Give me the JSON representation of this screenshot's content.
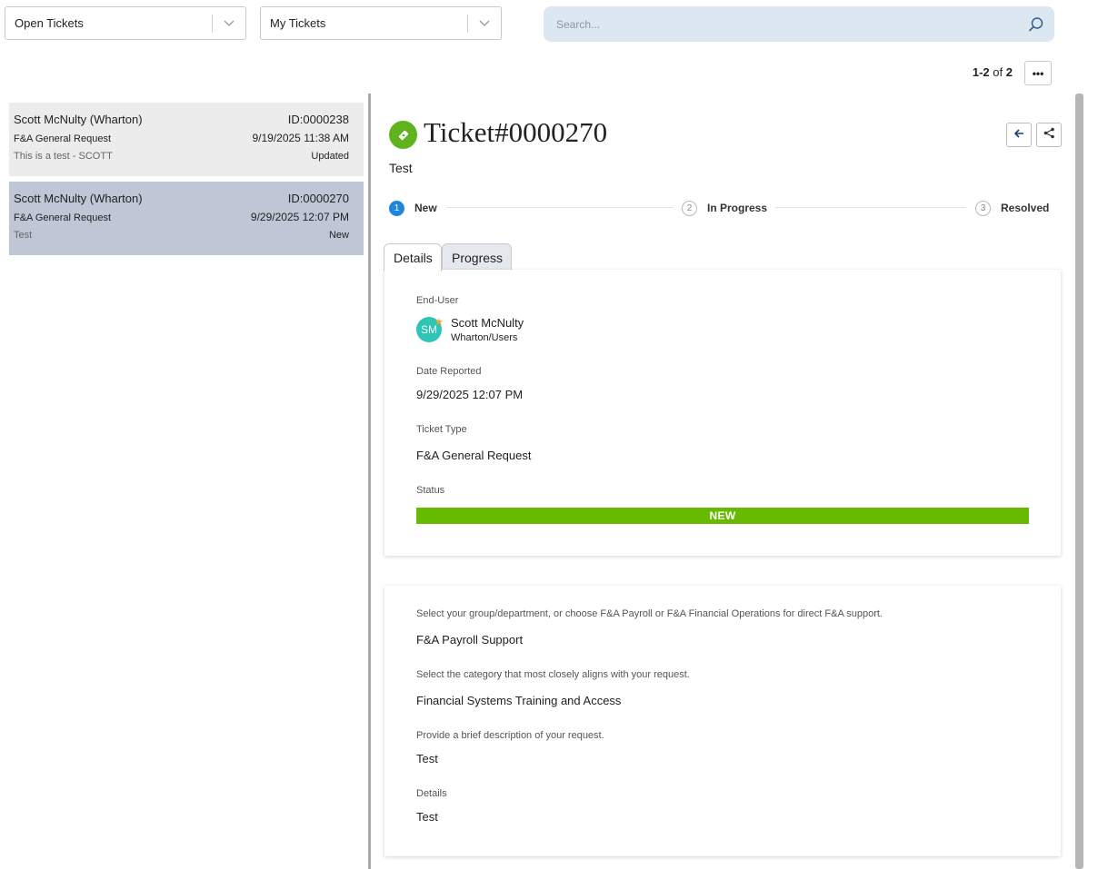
{
  "filters": {
    "queue": {
      "label": "Open Tickets"
    },
    "view": {
      "label": "My Tickets"
    }
  },
  "search": {
    "placeholder": "Search...",
    "icon": "search-icon"
  },
  "pager": {
    "range": "1-2",
    "of": "of",
    "total": "2",
    "more": "•••"
  },
  "tickets": [
    {
      "name": "Scott McNulty (Wharton)",
      "id": "ID:0000238",
      "type": "F&A General Request",
      "date": "9/19/2025 11:38 AM",
      "desc": "This is a test - SCOTT",
      "status": "Updated"
    },
    {
      "name": "Scott McNulty (Wharton)",
      "id": "ID:0000270",
      "type": "F&A General Request",
      "date": "9/29/2025 12:07 PM",
      "desc": "Test",
      "status": "New"
    }
  ],
  "detail": {
    "title": "Ticket#0000270",
    "subtitle": "Test",
    "steps": [
      {
        "num": "1",
        "label": "New",
        "active": true
      },
      {
        "num": "2",
        "label": "In Progress",
        "active": false
      },
      {
        "num": "3",
        "label": "Resolved",
        "active": false
      }
    ],
    "tabs": {
      "details": "Details",
      "progress": "Progress"
    },
    "fields": {
      "end_user_label": "End-User",
      "user_initials": "SM",
      "user_name": "Scott McNulty",
      "user_group": "Wharton/Users",
      "date_label": "Date Reported",
      "date_value": "9/29/2025 12:07 PM",
      "type_label": "Ticket Type",
      "type_value": "F&A General Request",
      "status_label": "Status",
      "status_value": "NEW",
      "status_color": "#66bb00"
    },
    "extra": {
      "q1_label": "Select your group/department, or choose F&A Payroll or F&A Financial Operations for direct F&A support.",
      "q1_value": "F&A Payroll Support",
      "q2_label": "Select the category that most closely aligns with your request.",
      "q2_value": "Financial Systems Training and Access",
      "q3_label": "Provide a brief description of your request.",
      "q3_value": "Test",
      "q4_label": "Details",
      "q4_value": "Test"
    }
  }
}
